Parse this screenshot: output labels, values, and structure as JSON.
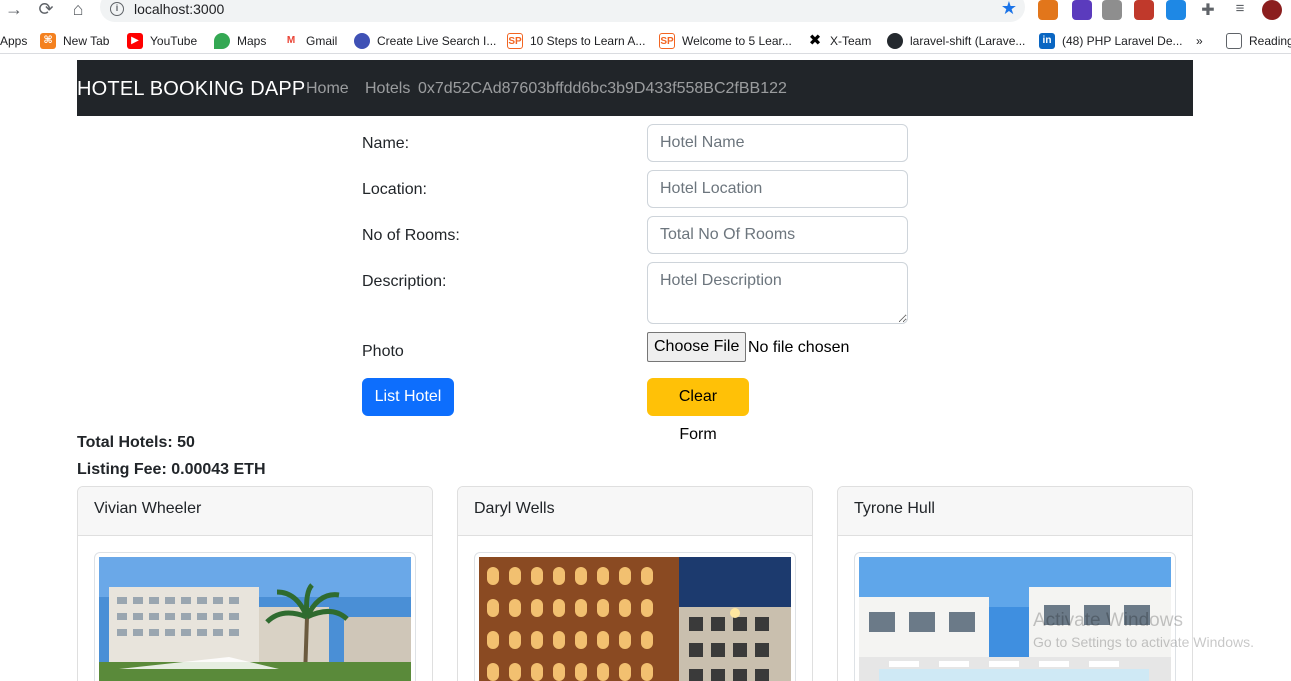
{
  "browser": {
    "url": "localhost:3000",
    "bookmarks": [
      {
        "label": "Apps",
        "icon": "apps-icon",
        "color": "#ffffff"
      },
      {
        "label": "New Tab",
        "icon": "newtab-icon",
        "color": "#f4811f"
      },
      {
        "label": "YouTube",
        "icon": "youtube-icon",
        "color": "#ff0000"
      },
      {
        "label": "Maps",
        "icon": "maps-icon",
        "color": "#34a853"
      },
      {
        "label": "Gmail",
        "icon": "gmail-icon",
        "color": "#ea4335"
      },
      {
        "label": "Create Live Search I...",
        "icon": "cloud-icon",
        "color": "#3f51b5"
      },
      {
        "label": "10 Steps to Learn A...",
        "icon": "sp-icon",
        "color": "#f26522"
      },
      {
        "label": "Welcome to 5 Lear...",
        "icon": "sp-icon",
        "color": "#f26522"
      },
      {
        "label": "X-Team",
        "icon": "x-icon",
        "color": "#000000"
      },
      {
        "label": "laravel-shift (Larave...",
        "icon": "github-icon",
        "color": "#24292e"
      },
      {
        "label": "(48) PHP Laravel De...",
        "icon": "linkedin-icon",
        "color": "#0a66c2"
      },
      {
        "label": "»",
        "icon": "more-icon",
        "color": "#5f6368"
      },
      {
        "label": "Reading",
        "icon": "reading-list-icon",
        "color": "#5f6368"
      }
    ]
  },
  "navbar": {
    "brand": "HOTEL BOOKING DAPP",
    "links": [
      "Home",
      "Hotels"
    ],
    "account": "0x7d52CAd87603bffdd6bc3b9D433f558BC2fBB122"
  },
  "form": {
    "name_label": "Name:",
    "name_placeholder": "Hotel Name",
    "location_label": "Location:",
    "location_placeholder": "Hotel Location",
    "rooms_label": "No of Rooms:",
    "rooms_placeholder": "Total No Of Rooms",
    "description_label": "Description:",
    "description_placeholder": "Hotel Description",
    "photo_label": "Photo",
    "file_button": "Choose File",
    "file_status": "No file chosen",
    "submit_label": "List Hotel",
    "clear_label": "Clear Form"
  },
  "stats": {
    "total_hotels": "Total Hotels: 50",
    "listing_fee": "Listing Fee: 0.00043 ETH"
  },
  "hotels": [
    {
      "owner": "Vivian Wheeler"
    },
    {
      "owner": "Daryl Wells"
    },
    {
      "owner": "Tyrone Hull"
    }
  ],
  "watermark": {
    "title": "Activate Windows",
    "subtitle": "Go to Settings to activate Windows."
  },
  "colors": {
    "navbar_bg": "#212529",
    "primary": "#0d6efd",
    "warning": "#ffc107"
  }
}
